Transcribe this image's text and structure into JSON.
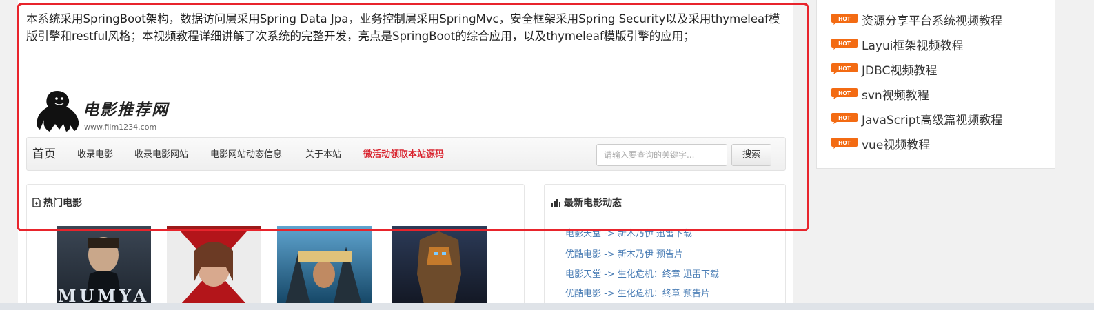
{
  "article": {
    "description": "本系统采用SpringBoot架构，数据访问层采用Spring Data Jpa，业务控制层采用SpringMvc，安全框架采用Spring Security以及采用thymeleaf模版引擎和restful风格；本视频教程详细讲解了次系统的完整开发，亮点是SpringBoot的综合应用，以及thymeleaf模版引擎的应用；"
  },
  "site": {
    "logo_icon": "gorilla-logo-icon",
    "logo_title": "电影推荐网",
    "logo_url": "www.film1234.com"
  },
  "nav": {
    "items": [
      "首页",
      "收录电影",
      "收录电影网站",
      "电影网站动态信息",
      "关于本站"
    ],
    "promo": "微活动领取本站源码",
    "search_placeholder": "请输入要查询的关键字...",
    "search_button": "搜索"
  },
  "hot_movies": {
    "title": "热门电影",
    "icon": "file-icon",
    "posters": [
      {
        "caption": "MUMYA",
        "colors": [
          "#2b3440",
          "#8d99a6"
        ]
      },
      {
        "caption": "",
        "colors": [
          "#9d1a1a",
          "#dcdcdc"
        ]
      },
      {
        "caption": "",
        "colors": [
          "#1d5f8c",
          "#e0c27a"
        ]
      },
      {
        "caption": "",
        "colors": [
          "#1e2436",
          "#b06a2a"
        ]
      }
    ]
  },
  "latest_news": {
    "title": "最新电影动态",
    "icon": "bar-chart-icon",
    "items": [
      "电影天堂 -> 新木乃伊 迅雷下载",
      "优酷电影 -> 新木乃伊 预告片",
      "电影天堂 -> 生化危机：终章 迅雷下载",
      "优酷电影 -> 生化危机：终章 预告片"
    ]
  },
  "sidebar": {
    "badge_text": "HOT",
    "items": [
      "资源分享平台系统视频教程",
      "Layui框架视频教程",
      "JDBC视频教程",
      "svn视频教程",
      "JavaScript高级篇视频教程",
      "vue视频教程"
    ]
  },
  "colors": {
    "highlight_frame": "#e8242c",
    "hot_badge": "#f36b13",
    "promo_link": "#d9232e",
    "news_link": "#4a7db5"
  }
}
